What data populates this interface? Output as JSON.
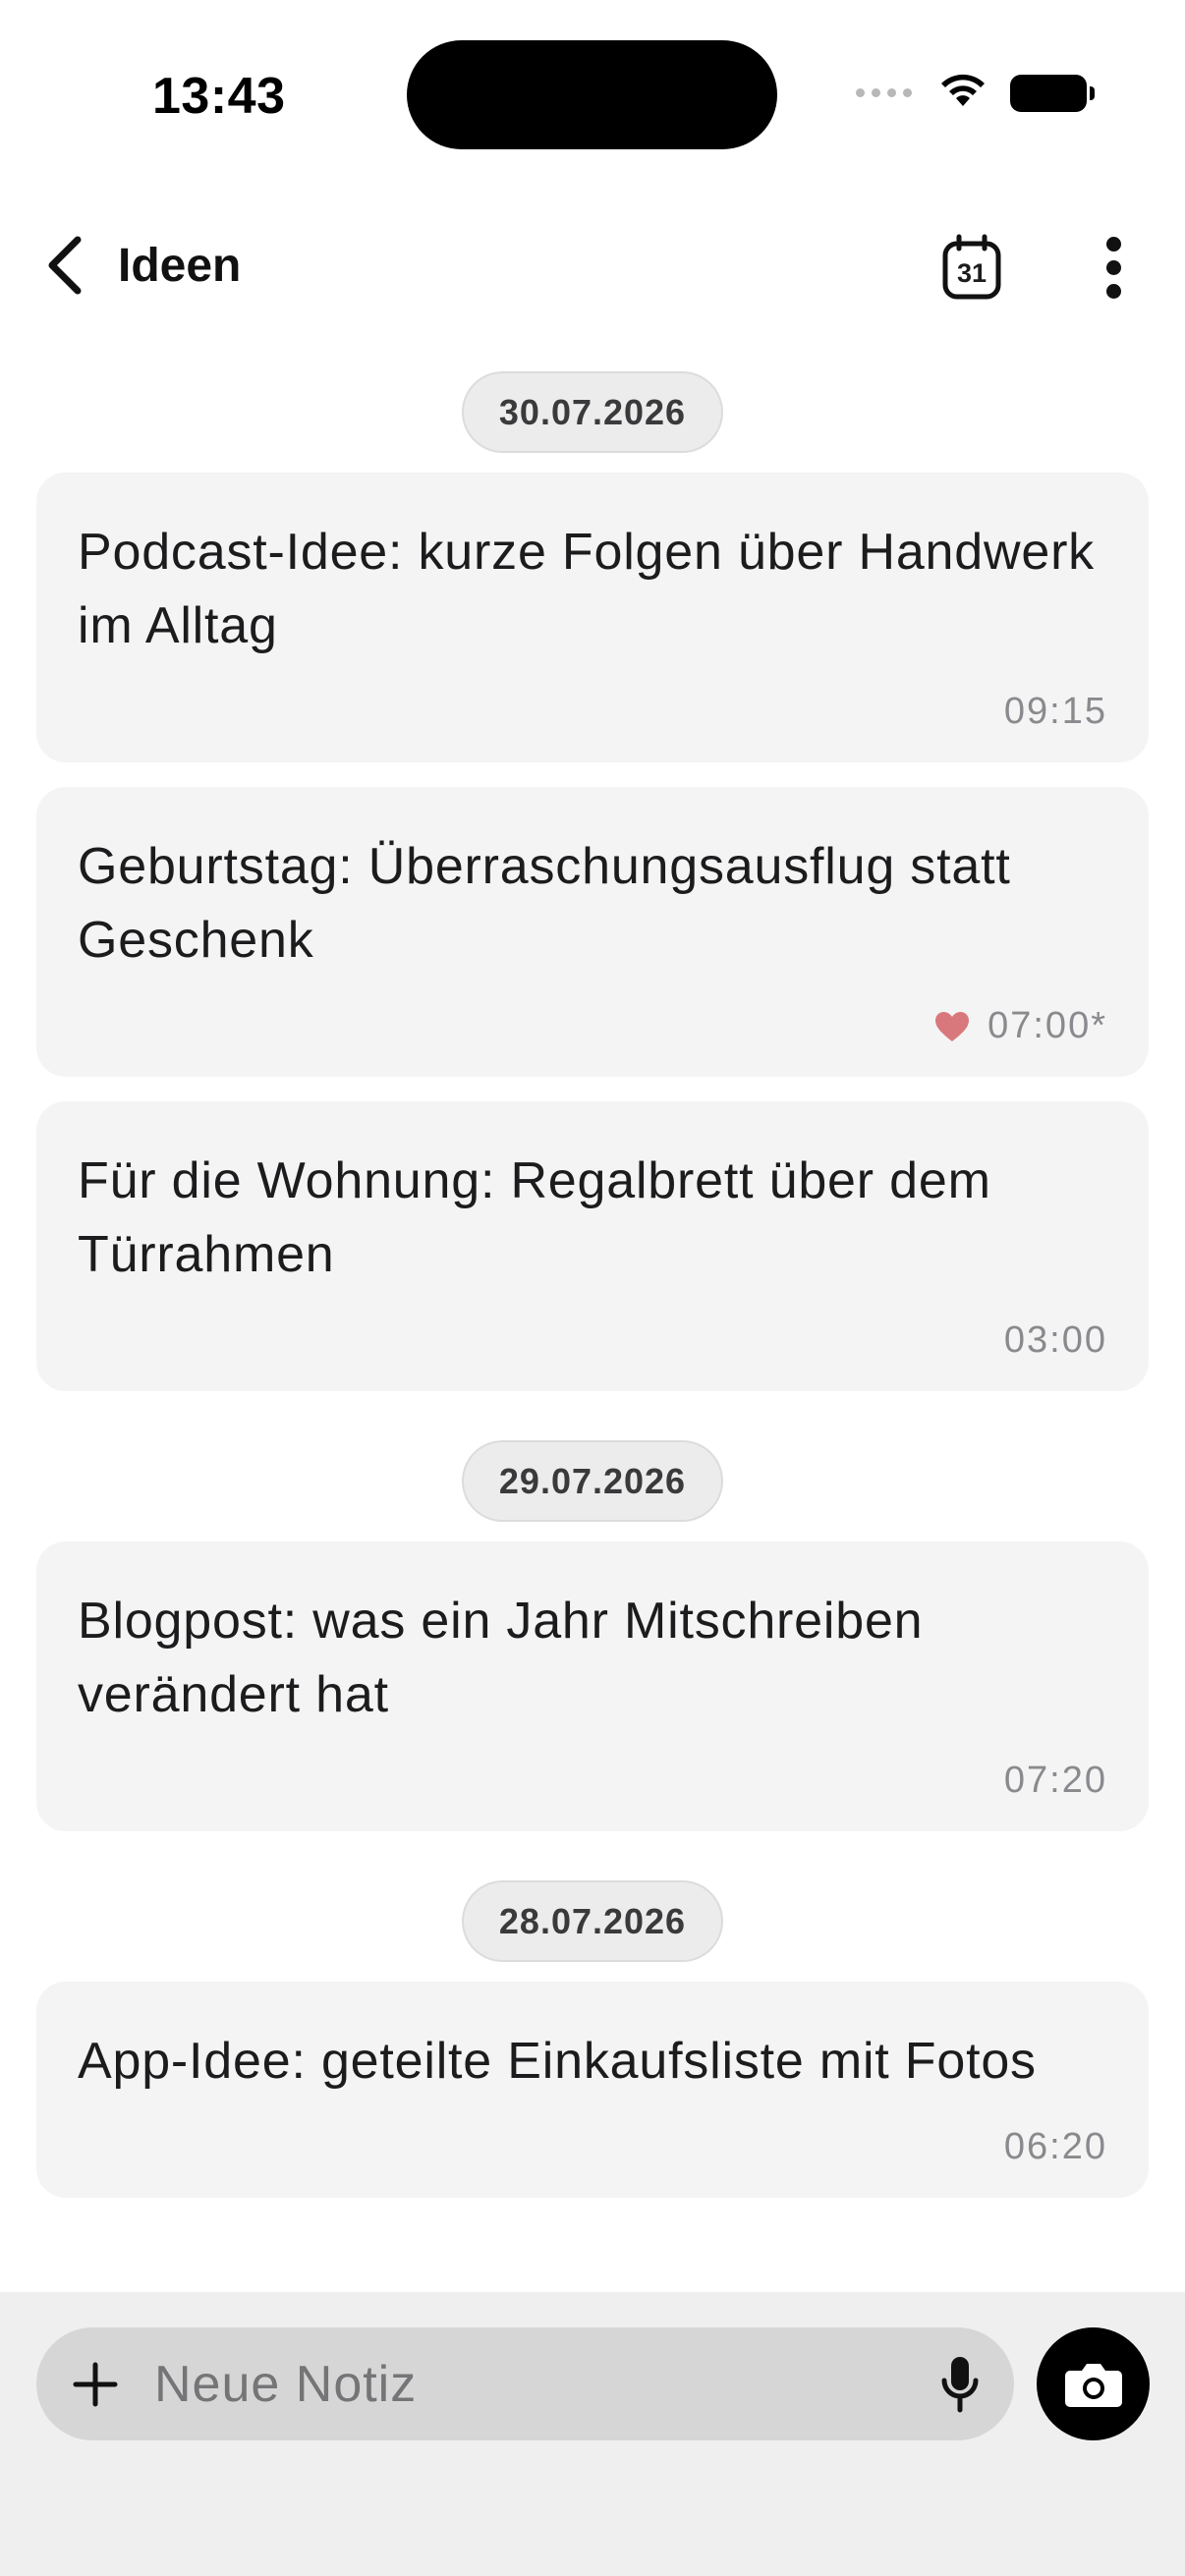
{
  "status_bar": {
    "time": "13:43"
  },
  "header": {
    "title": "Ideen",
    "calendar_day": "31"
  },
  "feed": {
    "groups": [
      {
        "date": "30.07.2026",
        "notes": [
          {
            "text": "Podcast-Idee: kurze Folgen über Handwerk im Alltag",
            "time": "09:15",
            "favorite": false
          },
          {
            "text": "Geburtstag: Überraschungsausflug statt Geschenk",
            "time": "07:00*",
            "favorite": true
          },
          {
            "text": "Für die Wohnung: Regalbrett über dem Türrahmen",
            "time": "03:00",
            "favorite": false
          }
        ]
      },
      {
        "date": "29.07.2026",
        "notes": [
          {
            "text": "Blogpost: was ein Jahr Mitschreiben verändert hat",
            "time": "07:20",
            "favorite": false
          }
        ]
      },
      {
        "date": "28.07.2026",
        "notes": [
          {
            "text": "App-Idee: geteilte Einkaufsliste mit Fotos",
            "time": "06:20",
            "favorite": false
          }
        ]
      }
    ]
  },
  "composer": {
    "placeholder": "Neue Notiz",
    "value": ""
  },
  "colors": {
    "heart": "#d9787c",
    "card_bg": "#f4f4f4",
    "chip_bg": "#ececec",
    "composer_bg": "#efefef",
    "input_bg": "#d6d6d6"
  },
  "icons": [
    "back-chevron-icon",
    "calendar-icon",
    "more-vertical-icon",
    "heart-icon",
    "plus-icon",
    "microphone-icon",
    "camera-icon",
    "wifi-icon",
    "battery-icon",
    "signal-icon"
  ]
}
